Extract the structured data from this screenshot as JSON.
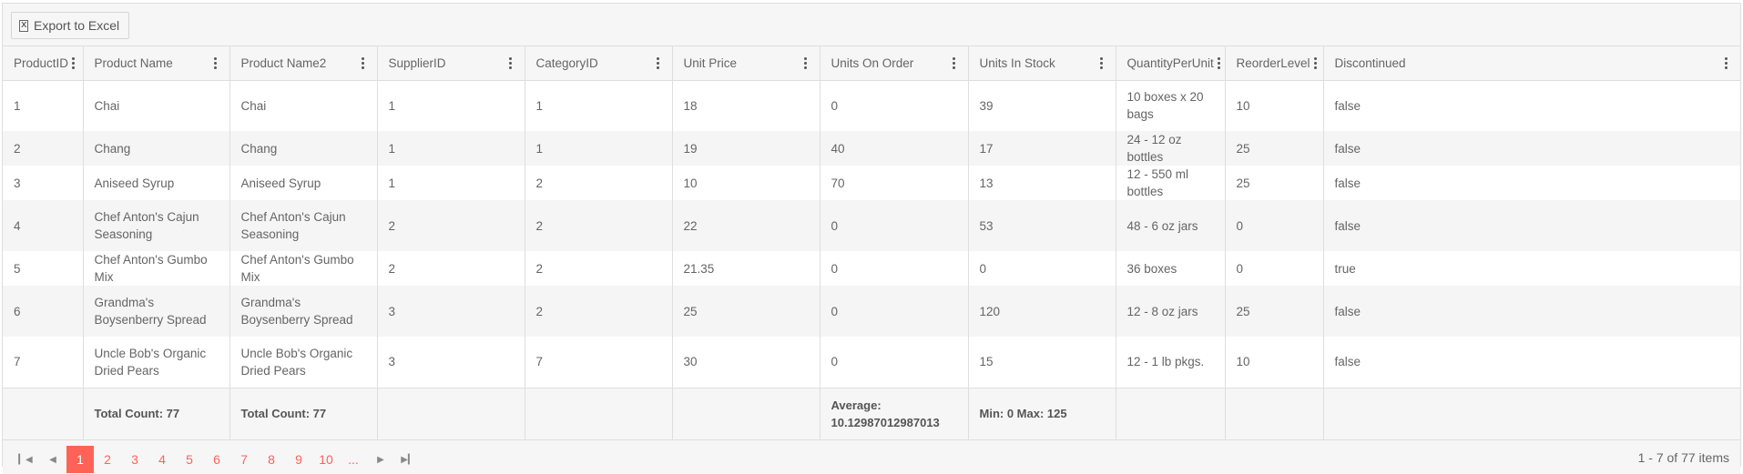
{
  "toolbar": {
    "export_label": "Export to Excel"
  },
  "columns": [
    "ProductID",
    "Product Name",
    "Product Name2",
    "SupplierID",
    "CategoryID",
    "Unit Price",
    "Units On Order",
    "Units In Stock",
    "QuantityPerUnit",
    "ReorderLevel",
    "Discontinued"
  ],
  "rows": [
    [
      "1",
      "Chai",
      "Chai",
      "1",
      "1",
      "18",
      "0",
      "39",
      "10 boxes x 20 bags",
      "10",
      "false"
    ],
    [
      "2",
      "Chang",
      "Chang",
      "1",
      "1",
      "19",
      "40",
      "17",
      "24 - 12 oz bottles",
      "25",
      "false"
    ],
    [
      "3",
      "Aniseed Syrup",
      "Aniseed Syrup",
      "1",
      "2",
      "10",
      "70",
      "13",
      "12 - 550 ml bottles",
      "25",
      "false"
    ],
    [
      "4",
      "Chef Anton's Cajun Seasoning",
      "Chef Anton's Cajun Seasoning",
      "2",
      "2",
      "22",
      "0",
      "53",
      "48 - 6 oz jars",
      "0",
      "false"
    ],
    [
      "5",
      "Chef Anton's Gumbo Mix",
      "Chef Anton's Gumbo Mix",
      "2",
      "2",
      "21.35",
      "0",
      "0",
      "36 boxes",
      "0",
      "true"
    ],
    [
      "6",
      "Grandma's Boysenberry Spread",
      "Grandma's Boysenberry Spread",
      "3",
      "2",
      "25",
      "0",
      "120",
      "12 - 8 oz jars",
      "25",
      "false"
    ],
    [
      "7",
      "Uncle Bob's Organic Dried Pears",
      "Uncle Bob's Organic Dried Pears",
      "3",
      "7",
      "30",
      "0",
      "15",
      "12 - 1 lb pkgs.",
      "10",
      "false"
    ]
  ],
  "footer": [
    "",
    "Total Count: 77",
    "Total Count: 77",
    "",
    "",
    "",
    "Average: 10.12987012987013",
    "Min: 0 Max: 125",
    "",
    "",
    ""
  ],
  "pager": {
    "pages": [
      "1",
      "2",
      "3",
      "4",
      "5",
      "6",
      "7",
      "8",
      "9",
      "10",
      "..."
    ],
    "active_page": "1",
    "first_icon": "first-page-icon",
    "prev_icon": "prev-page-icon",
    "next_icon": "next-page-icon",
    "last_icon": "last-page-icon",
    "info": "1 - 7 of 77 items"
  },
  "colors": {
    "accent": "#ff6358",
    "header_bg": "#f6f6f6",
    "alt_row": "#f5f5f5",
    "border": "#dedede"
  }
}
